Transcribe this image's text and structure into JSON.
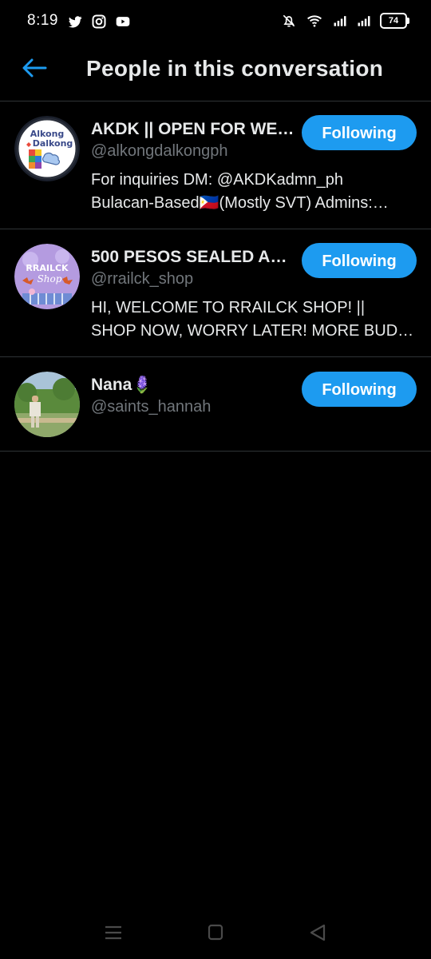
{
  "status_bar": {
    "time": "8:19",
    "battery": "74",
    "left_icons": [
      "twitter-icon",
      "instagram-icon",
      "youtube-icon"
    ],
    "right_icons": [
      "mute-bell-icon",
      "wifi-icon",
      "signal-icon",
      "signal-icon",
      "battery-icon"
    ]
  },
  "header": {
    "title": "People in this conversation",
    "back_icon": "arrow-left-icon"
  },
  "colors": {
    "background": "#000000",
    "accent": "#1d9bf0",
    "text": "#e7e9ea",
    "muted": "#71767b",
    "divider": "#2f3336"
  },
  "people": [
    {
      "name": "AKDK || OPEN FOR WEV…",
      "handle": "@alkongdalkongph",
      "bio": [
        "For inquiries DM: @AKDKadmn_ph",
        "Bulacan-Based🇵🇭(Mostly SVT) Admins:…"
      ],
      "button": "Following",
      "avatar_text": "Alkong Dalkong"
    },
    {
      "name": "500 PESOS SEALED AN…",
      "handle": "@rrailck_shop",
      "bio": [
        "HI, WELCOME TO RRAILCK SHOP! ||",
        "SHOP NOW, WORRY LATER! MORE BUD…"
      ],
      "button": "Following",
      "avatar_text": "RRAILCK Shop"
    },
    {
      "name": "Nana🪻",
      "handle": "@saints_hannah",
      "bio": [],
      "button": "Following"
    }
  ],
  "nav": {
    "icons": [
      "menu-icon",
      "home-square-icon",
      "back-triangle-icon"
    ]
  }
}
